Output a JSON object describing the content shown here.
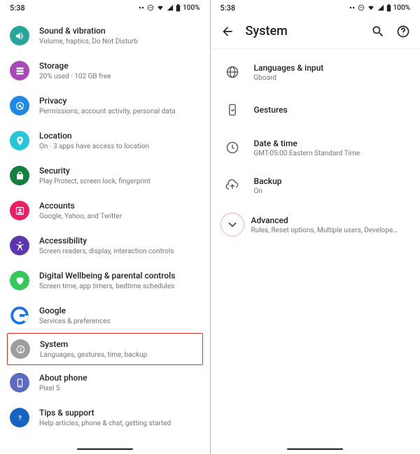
{
  "status": {
    "time": "5:38",
    "battery": "100%"
  },
  "left": {
    "items": [
      {
        "title": "Sound & vibration",
        "subtitle": "Volume, haptics, Do Not Disturb"
      },
      {
        "title": "Storage",
        "subtitle": "20% used · 102 GB free"
      },
      {
        "title": "Privacy",
        "subtitle": "Permissions, account activity, personal data"
      },
      {
        "title": "Location",
        "subtitle": "On · 3 apps have access to location"
      },
      {
        "title": "Security",
        "subtitle": "Play Protect, screen lock, fingerprint"
      },
      {
        "title": "Accounts",
        "subtitle": "Google, Yahoo, and Twitter"
      },
      {
        "title": "Accessibility",
        "subtitle": "Screen readers, display, interaction controls"
      },
      {
        "title": "Digital Wellbeing & parental controls",
        "subtitle": "Screen time, app timers, bedtime schedules"
      },
      {
        "title": "Google",
        "subtitle": "Services & preferences"
      },
      {
        "title": "System",
        "subtitle": "Languages, gestures, time, backup"
      },
      {
        "title": "About phone",
        "subtitle": "Pixel 5"
      },
      {
        "title": "Tips & support",
        "subtitle": "Help articles, phone & chat, getting started"
      }
    ]
  },
  "right": {
    "page_title": "System",
    "items": [
      {
        "title": "Languages & input",
        "subtitle": "Gboard"
      },
      {
        "title": "Gestures",
        "subtitle": ""
      },
      {
        "title": "Date & time",
        "subtitle": "GMT-05:00 Eastern Standard Time"
      },
      {
        "title": "Backup",
        "subtitle": "On"
      },
      {
        "title": "Advanced",
        "subtitle": "Rules, Reset options, Multiple users, Developer options,.."
      }
    ]
  },
  "colors": {
    "teal": "#26a69a",
    "purple": "#ab47bc",
    "blue": "#1e88e5",
    "cyan": "#26c6da",
    "green": "#15803d",
    "pink": "#e91e63",
    "indigo": "#5e35b1",
    "mint": "#34c759",
    "gblue": "#1a73e8",
    "grey": "#9e9e9e",
    "slate": "#5c6bc0",
    "navy": "#1565c0"
  }
}
